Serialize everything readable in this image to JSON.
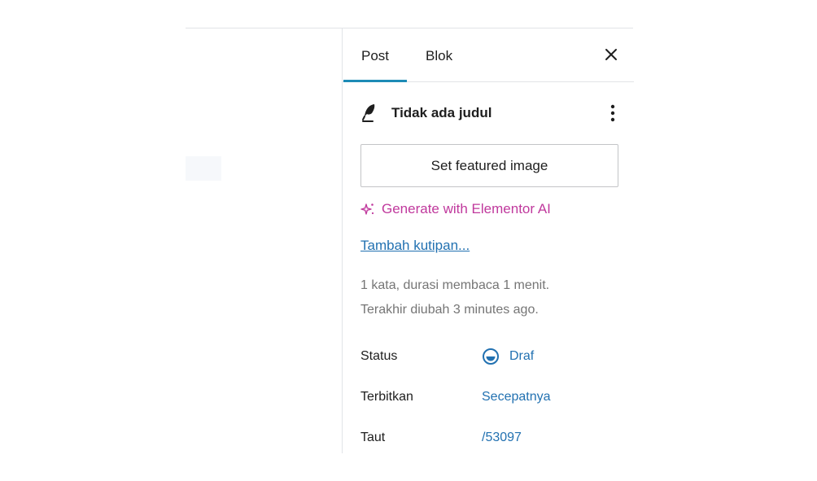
{
  "sidebar": {
    "tabs": [
      {
        "label": "Post",
        "active": true
      },
      {
        "label": "Blok",
        "active": false
      }
    ],
    "close_icon": "close-icon",
    "post": {
      "icon": "feather-icon",
      "title": "Tidak ada judul",
      "more_icon": "vertical-ellipsis-icon"
    },
    "featured_image_label": "Set featured image",
    "generate_ai": {
      "icon": "sparkle-icon",
      "label": "Generate with Elementor AI"
    },
    "excerpt_link": "Tambah kutipan...",
    "meta_words": "1 kata, durasi membaca 1 menit.",
    "meta_modified": "Terakhir diubah 3 minutes ago.",
    "fields": {
      "status": {
        "label": "Status",
        "value": "Draf",
        "icon": "draft-status-icon"
      },
      "publish": {
        "label": "Terbitkan",
        "value": "Secepatnya"
      },
      "link": {
        "label": "Taut",
        "value": "/53097"
      }
    }
  },
  "colors": {
    "accent": "#1d8bb6",
    "link": "#2271b1",
    "ai": "#c0399d",
    "muted_text": "#757575",
    "border": "#e2e4e7"
  }
}
